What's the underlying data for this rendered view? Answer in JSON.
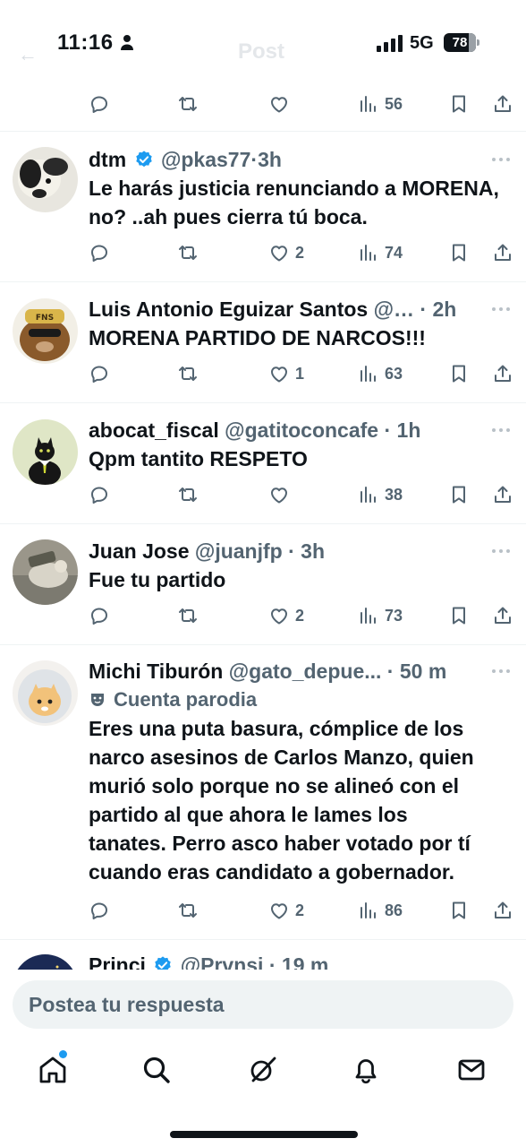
{
  "status_bar": {
    "time": "11:16",
    "network": "5G",
    "battery": "78",
    "battery_level_percent": 78,
    "faded_header_title": "Post"
  },
  "posts": [
    {
      "name": "",
      "handle": "",
      "time": "",
      "text": "",
      "actions": {
        "likes": "",
        "views": "56"
      }
    },
    {
      "name": "dtm",
      "verified": true,
      "handle": "@pkas77",
      "time": "3h",
      "text": "Le harás justicia renunciando a MORENA, no? ..ah pues cierra tú boca.",
      "actions": {
        "likes": "2",
        "views": "74"
      }
    },
    {
      "name": "Luis Antonio Eguizar Santos",
      "handle": "@…",
      "time": "2h",
      "text": "MORENA PARTIDO DE NARCOS!!!",
      "actions": {
        "likes": "1",
        "views": "63"
      }
    },
    {
      "name": "abocat_fiscal",
      "handle": "@gatitoconcafe",
      "time": "1h",
      "text": "Qpm tantito RESPETO",
      "actions": {
        "likes": "",
        "views": "38"
      }
    },
    {
      "name": "Juan Jose",
      "handle": "@juanjfp",
      "time": "3h",
      "text": "Fue tu partido",
      "actions": {
        "likes": "2",
        "views": "73"
      }
    },
    {
      "name": "Michi Tiburón",
      "handle": "@gato_depue...",
      "time": "50 m",
      "label": "Cuenta parodia",
      "text_lines": [
        "Eres una puta basura, cómplice de los",
        "narco asesinos de Carlos Manzo, quien",
        "murió solo porque no se alineó con el",
        "partido al que ahora le lames los",
        "tanates. Perro asco haber votado por tí",
        "cuando eras candidato a gobernador."
      ],
      "actions": {
        "likes": "2",
        "views": "86"
      }
    },
    {
      "name": "Princi",
      "verified": true,
      "handle": "@Prvnsi",
      "time": "19 m"
    }
  ],
  "reply": {
    "placeholder": "Postea tu respuesta"
  },
  "tabbar": {
    "icons": [
      "home-icon",
      "search-icon",
      "grok-icon",
      "notifications-icon",
      "messages-icon"
    ],
    "accent": "#1d9bf0"
  },
  "colors": {
    "text": "#0f1419",
    "secondary": "#536471",
    "verified": "#1d9bf0"
  }
}
